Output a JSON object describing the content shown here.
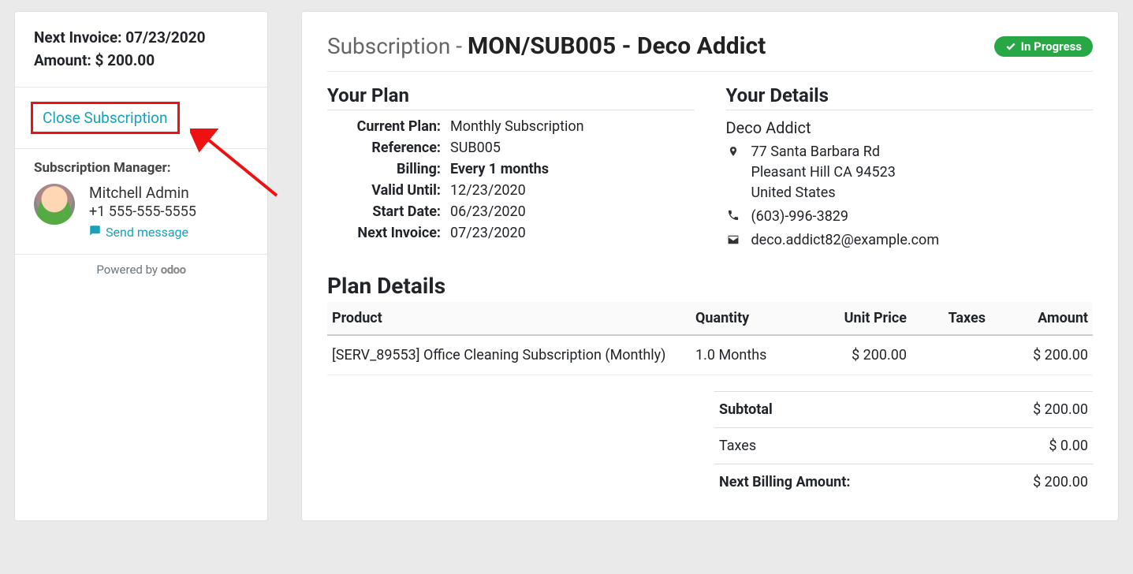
{
  "sidebar": {
    "next_invoice_label": "Next Invoice:",
    "next_invoice_date": "07/23/2020",
    "amount_label": "Amount:",
    "amount_value": "$ 200.00",
    "close_subscription_label": "Close Subscription",
    "manager_heading": "Subscription Manager:",
    "manager_name": "Mitchell Admin",
    "manager_phone": "+1 555-555-5555",
    "send_message_label": "Send message",
    "powered_by_label": "Powered by",
    "powered_by_brand": "odoo"
  },
  "header": {
    "prefix": "Subscription - ",
    "title": "MON/SUB005 - Deco Addict",
    "status": "In Progress"
  },
  "plan": {
    "heading": "Your Plan",
    "current_plan_label": "Current Plan:",
    "current_plan_value": "Monthly Subscription",
    "reference_label": "Reference:",
    "reference_value": "SUB005",
    "billing_label": "Billing:",
    "billing_value": "Every 1 months",
    "valid_until_label": "Valid Until:",
    "valid_until_value": "12/23/2020",
    "start_date_label": "Start Date:",
    "start_date_value": "06/23/2020",
    "next_invoice_label": "Next Invoice:",
    "next_invoice_value": "07/23/2020"
  },
  "details": {
    "heading": "Your Details",
    "name": "Deco Addict",
    "address_line1": "77 Santa Barbara Rd",
    "address_line2": "Pleasant Hill CA 94523",
    "address_country": "United States",
    "phone": "(603)-996-3829",
    "email": "deco.addict82@example.com"
  },
  "plan_details": {
    "heading": "Plan Details",
    "columns": {
      "product": "Product",
      "quantity": "Quantity",
      "unit_price": "Unit Price",
      "taxes": "Taxes",
      "amount": "Amount"
    },
    "rows": [
      {
        "product": "[SERV_89553] Office Cleaning Subscription (Monthly)",
        "quantity": "1.0 Months",
        "unit_price": "$ 200.00",
        "taxes": "",
        "amount": "$ 200.00"
      }
    ],
    "totals": {
      "subtotal_label": "Subtotal",
      "subtotal_value": "$ 200.00",
      "taxes_label": "Taxes",
      "taxes_value": "$ 0.00",
      "next_billing_label": "Next Billing Amount:",
      "next_billing_value": "$ 200.00"
    }
  }
}
